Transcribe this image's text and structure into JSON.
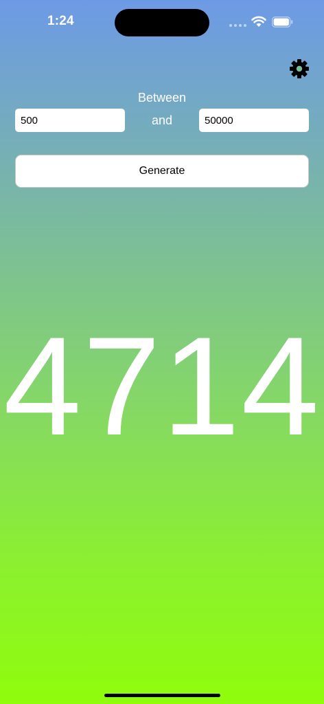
{
  "status_bar": {
    "time": "1:24",
    "icons": [
      "signal-icon",
      "wifi-icon",
      "battery-icon"
    ]
  },
  "settings": {
    "icon": "gear-icon"
  },
  "range": {
    "between_label": "Between",
    "and_label": "and",
    "min_value": "500",
    "max_value": "50000"
  },
  "generate": {
    "label": "Generate"
  },
  "result": {
    "value": "4714"
  },
  "colors": {
    "gradient_top": "#6d9ae6",
    "gradient_bottom": "#8ffd0c",
    "text": "#ffffff"
  }
}
